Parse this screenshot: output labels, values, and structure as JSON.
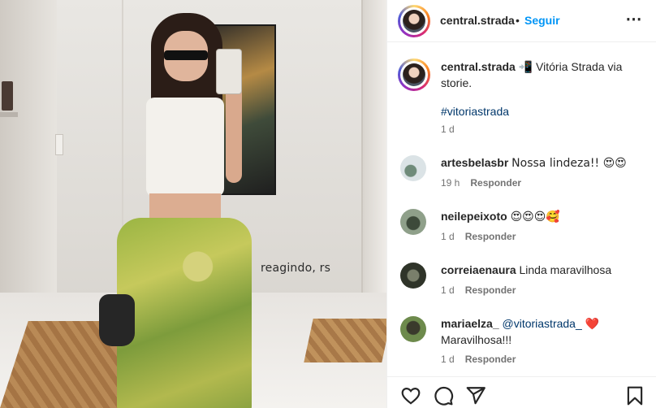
{
  "photo": {
    "overlay_text": "reagindo, rs"
  },
  "post_header": {
    "username": "central.strada",
    "separator": "•",
    "follow_label": "Seguir",
    "more_icon": "more-horizontal-icon"
  },
  "caption": {
    "username": "central.strada",
    "emoji": "📲",
    "text": "Vitória Strada via storie.",
    "hashtag": "#vitoriastrada",
    "time": "1 d"
  },
  "comments": [
    {
      "username": "artesbelasbr",
      "text": "Nossa lindeza!! 😍😍",
      "time": "19 h",
      "reply_label": "Responder"
    },
    {
      "username": "neilepeixoto",
      "text": "😍😍😍🥰",
      "time": "1 d",
      "reply_label": "Responder"
    },
    {
      "username": "correiaenaura",
      "text": "Linda maravilhosa",
      "time": "1 d",
      "reply_label": "Responder"
    },
    {
      "username": "mariaelza_",
      "mention": "@vitoriastrada_",
      "heart": "❤️",
      "text2": "Maravilhosa!!!",
      "time": "1 d",
      "reply_label": "Responder"
    }
  ],
  "actions": {
    "like_icon": "heart-icon",
    "comment_icon": "comment-icon",
    "share_icon": "send-icon",
    "save_icon": "bookmark-icon"
  },
  "colors": {
    "accent_blue": "#0095f6",
    "link_dark_blue": "#00376b",
    "meta_gray": "#737373",
    "text": "#262626"
  }
}
